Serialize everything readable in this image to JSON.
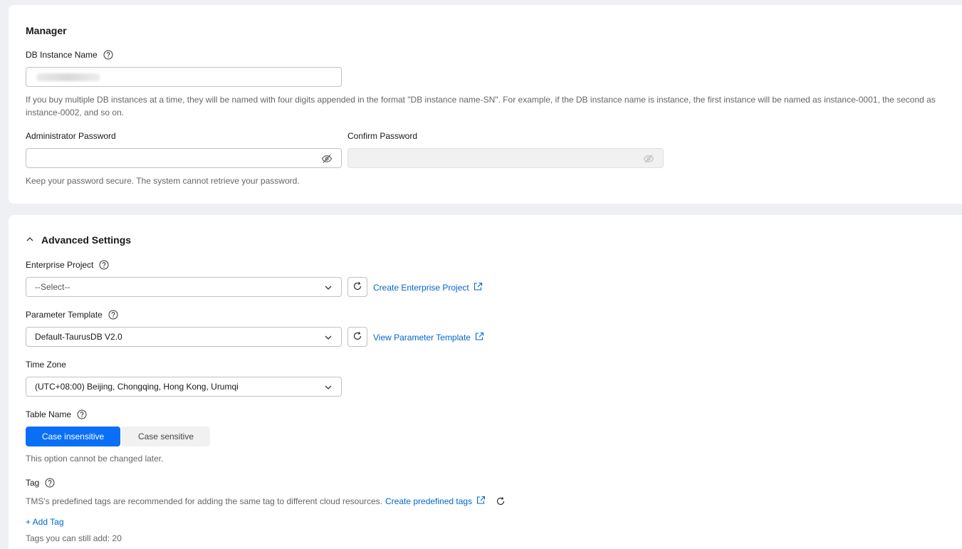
{
  "manager": {
    "title": "Manager",
    "db_instance_name_label": "DB Instance Name",
    "db_instance_name_hint": "If you buy multiple DB instances at a time, they will be named with four digits appended in the format \"DB instance name-SN\". For example, if the DB instance name is instance, the first instance will be named as instance-0001, the second as instance-0002, and so on.",
    "admin_password_label": "Administrator Password",
    "confirm_password_label": "Confirm Password",
    "password_hint": "Keep your password secure. The system cannot retrieve your password."
  },
  "advanced": {
    "title": "Advanced Settings",
    "enterprise_project_label": "Enterprise Project",
    "enterprise_project_value": "--Select--",
    "create_enterprise_project_link": "Create Enterprise Project",
    "parameter_template_label": "Parameter Template",
    "parameter_template_value": "Default-TaurusDB V2.0",
    "view_parameter_template_link": "View Parameter Template",
    "time_zone_label": "Time Zone",
    "time_zone_value": "(UTC+08:00) Beijing, Chongqing, Hong Kong, Urumqi",
    "table_name_label": "Table Name",
    "table_name_options": [
      "Case insensitive",
      "Case sensitive"
    ],
    "table_name_hint": "This option cannot be changed later.",
    "tag_label": "Tag",
    "tag_hint": "TMS's predefined tags are recommended for adding the same tag to different cloud resources.",
    "create_predefined_tags_link": "Create predefined tags",
    "add_tag_link": "+ Add Tag",
    "tags_remaining": "Tags you can still add: 20"
  },
  "colors": {
    "primary": "#0a6ff7",
    "link": "#0066cc",
    "background": "#eff0f3"
  }
}
